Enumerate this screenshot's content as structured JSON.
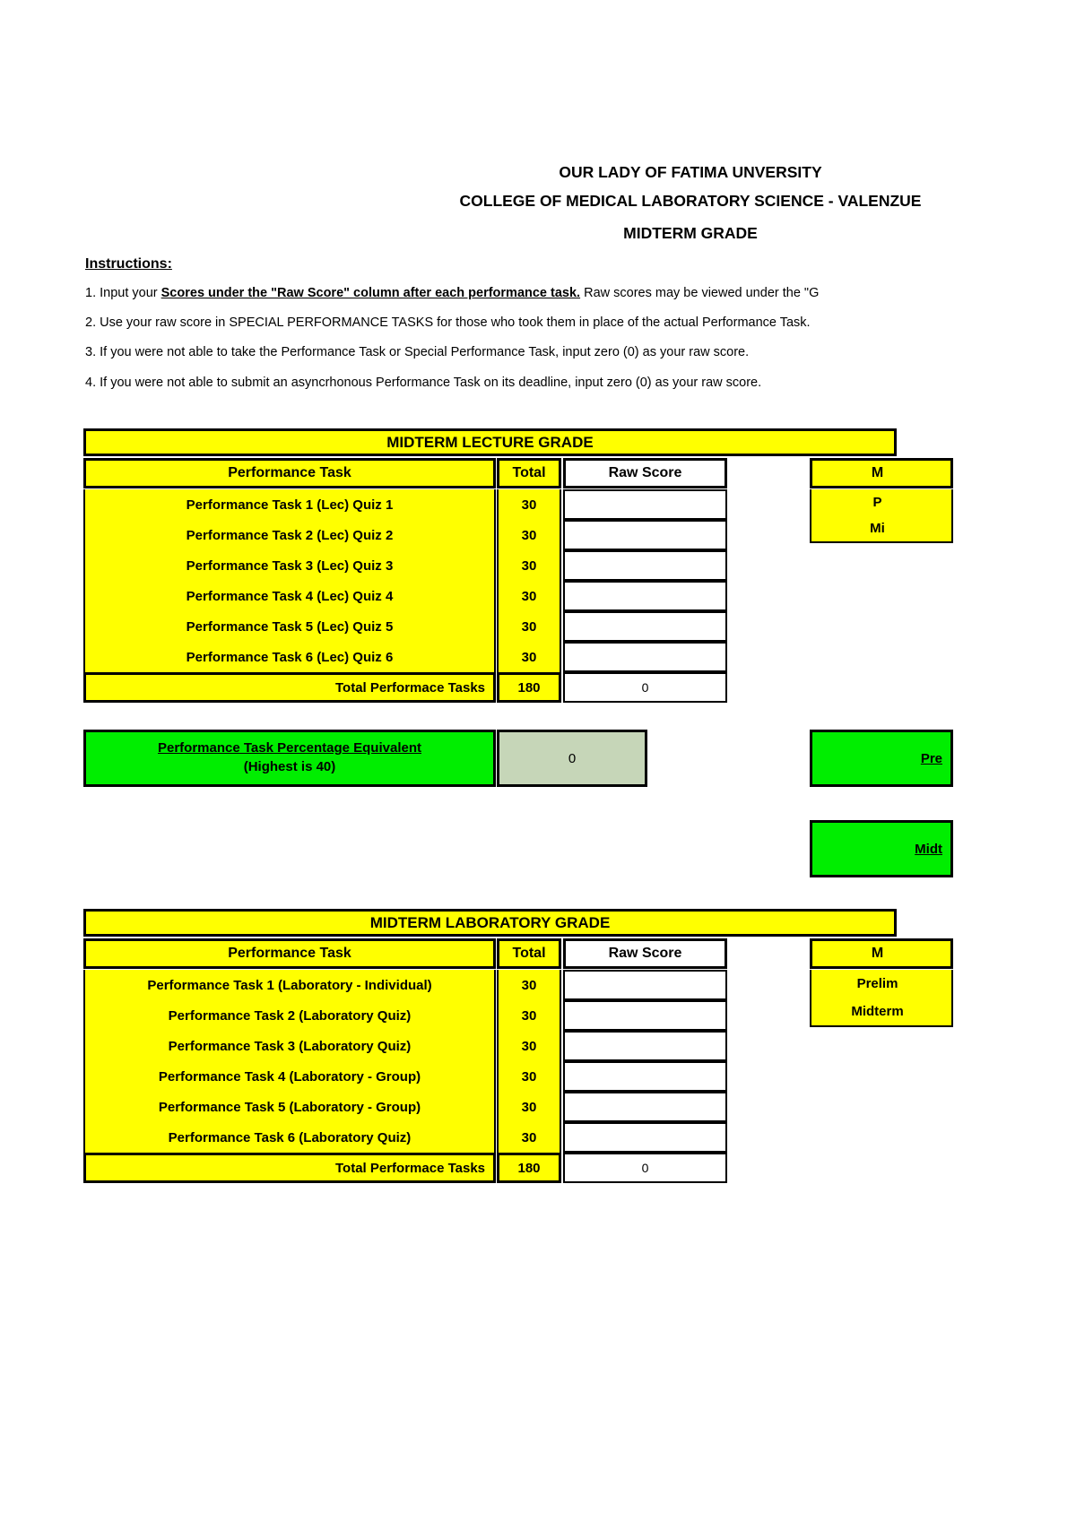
{
  "header": {
    "line1": "OUR LADY OF FATIMA UNVERSITY",
    "line2": "COLLEGE OF MEDICAL LABORATORY SCIENCE - VALENZUE",
    "line3": "MIDTERM GRADE"
  },
  "instructions": {
    "title": "Instructions:",
    "item1_pre": "1. Input your ",
    "item1_bold": "Scores under the \"Raw Score\" column after each performance task.",
    "item1_post": " Raw scores may be viewed under the \"G",
    "item2": "2. Use your raw score in SPECIAL PERFORMANCE TASKS for those who took them in place of the actual Performance Task.",
    "item3": "3. If you were not able to take the Performance Task or Special Performance Task, input zero (0) as your raw score.",
    "item4": "4. If you were not able to submit an asyncrhonous Performance Task on its deadline, input zero (0) as your raw score."
  },
  "lecture": {
    "banner": "MIDTERM LECTURE GRADE",
    "col_task": "Performance Task",
    "col_total": "Total",
    "col_raw": "Raw Score",
    "rows": [
      {
        "task": "Performance Task 1 (Lec) Quiz 1",
        "total": "30",
        "raw": ""
      },
      {
        "task": "Performance Task 2 (Lec) Quiz 2",
        "total": "30",
        "raw": ""
      },
      {
        "task": "Performance Task 3 (Lec) Quiz 3",
        "total": "30",
        "raw": ""
      },
      {
        "task": "Performance Task 4 (Lec) Quiz 4",
        "total": "30",
        "raw": ""
      },
      {
        "task": "Performance Task 5 (Lec) Quiz 5",
        "total": "30",
        "raw": ""
      },
      {
        "task": "Performance Task 6 (Lec) Quiz 6",
        "total": "30",
        "raw": ""
      }
    ],
    "total_label": "Total Performace Tasks",
    "total_value": "180",
    "total_raw": "0",
    "side_panel": {
      "header": "M",
      "row1": "P",
      "row2": "Mi"
    },
    "percent_label_line1": "Performance Task Percentage Equivalent",
    "percent_label_line2": "(Highest is 40)",
    "percent_value": "0",
    "side_green1": "Pre",
    "side_green2": "Midt"
  },
  "laboratory": {
    "banner": "MIDTERM LABORATORY GRADE",
    "col_task": "Performance Task",
    "col_total": "Total",
    "col_raw": "Raw Score",
    "rows": [
      {
        "task": "Performance Task 1 (Laboratory - Individual)",
        "total": "30",
        "raw": ""
      },
      {
        "task": "Performance Task 2 (Laboratory Quiz)",
        "total": "30",
        "raw": ""
      },
      {
        "task": "Performance Task 3 (Laboratory Quiz)",
        "total": "30",
        "raw": ""
      },
      {
        "task": "Performance Task 4  (Laboratory - Group)",
        "total": "30",
        "raw": ""
      },
      {
        "task": "Performance Task 5 (Laboratory - Group)",
        "total": "30",
        "raw": ""
      },
      {
        "task": "Performance Task 6 (Laboratory Quiz)",
        "total": "30",
        "raw": ""
      }
    ],
    "total_label": "Total Performace Tasks",
    "total_value": "180",
    "total_raw": "0",
    "side_panel": {
      "header": "M",
      "row1": "Prelim",
      "row2": "Midterm"
    }
  },
  "colors": {
    "yellow": "#ffff00",
    "green": "#00ee00",
    "gray_green": "#c6d6b8",
    "white": "#ffffff",
    "border": "#000000"
  }
}
